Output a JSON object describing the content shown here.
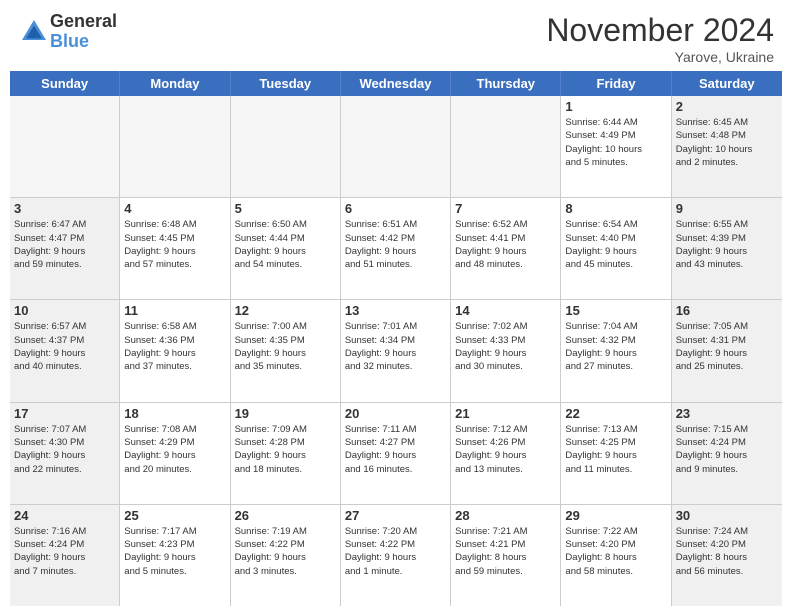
{
  "header": {
    "logo_general": "General",
    "logo_blue": "Blue",
    "month_title": "November 2024",
    "location": "Yarove, Ukraine"
  },
  "weekdays": [
    "Sunday",
    "Monday",
    "Tuesday",
    "Wednesday",
    "Thursday",
    "Friday",
    "Saturday"
  ],
  "rows": [
    [
      {
        "day": "",
        "empty": true
      },
      {
        "day": "",
        "empty": true
      },
      {
        "day": "",
        "empty": true
      },
      {
        "day": "",
        "empty": true
      },
      {
        "day": "",
        "empty": true
      },
      {
        "day": "1",
        "info": "Sunrise: 6:44 AM\nSunset: 4:49 PM\nDaylight: 10 hours\nand 5 minutes."
      },
      {
        "day": "2",
        "info": "Sunrise: 6:45 AM\nSunset: 4:48 PM\nDaylight: 10 hours\nand 2 minutes."
      }
    ],
    [
      {
        "day": "3",
        "info": "Sunrise: 6:47 AM\nSunset: 4:47 PM\nDaylight: 9 hours\nand 59 minutes."
      },
      {
        "day": "4",
        "info": "Sunrise: 6:48 AM\nSunset: 4:45 PM\nDaylight: 9 hours\nand 57 minutes."
      },
      {
        "day": "5",
        "info": "Sunrise: 6:50 AM\nSunset: 4:44 PM\nDaylight: 9 hours\nand 54 minutes."
      },
      {
        "day": "6",
        "info": "Sunrise: 6:51 AM\nSunset: 4:42 PM\nDaylight: 9 hours\nand 51 minutes."
      },
      {
        "day": "7",
        "info": "Sunrise: 6:52 AM\nSunset: 4:41 PM\nDaylight: 9 hours\nand 48 minutes."
      },
      {
        "day": "8",
        "info": "Sunrise: 6:54 AM\nSunset: 4:40 PM\nDaylight: 9 hours\nand 45 minutes."
      },
      {
        "day": "9",
        "info": "Sunrise: 6:55 AM\nSunset: 4:39 PM\nDaylight: 9 hours\nand 43 minutes."
      }
    ],
    [
      {
        "day": "10",
        "info": "Sunrise: 6:57 AM\nSunset: 4:37 PM\nDaylight: 9 hours\nand 40 minutes."
      },
      {
        "day": "11",
        "info": "Sunrise: 6:58 AM\nSunset: 4:36 PM\nDaylight: 9 hours\nand 37 minutes."
      },
      {
        "day": "12",
        "info": "Sunrise: 7:00 AM\nSunset: 4:35 PM\nDaylight: 9 hours\nand 35 minutes."
      },
      {
        "day": "13",
        "info": "Sunrise: 7:01 AM\nSunset: 4:34 PM\nDaylight: 9 hours\nand 32 minutes."
      },
      {
        "day": "14",
        "info": "Sunrise: 7:02 AM\nSunset: 4:33 PM\nDaylight: 9 hours\nand 30 minutes."
      },
      {
        "day": "15",
        "info": "Sunrise: 7:04 AM\nSunset: 4:32 PM\nDaylight: 9 hours\nand 27 minutes."
      },
      {
        "day": "16",
        "info": "Sunrise: 7:05 AM\nSunset: 4:31 PM\nDaylight: 9 hours\nand 25 minutes."
      }
    ],
    [
      {
        "day": "17",
        "info": "Sunrise: 7:07 AM\nSunset: 4:30 PM\nDaylight: 9 hours\nand 22 minutes."
      },
      {
        "day": "18",
        "info": "Sunrise: 7:08 AM\nSunset: 4:29 PM\nDaylight: 9 hours\nand 20 minutes."
      },
      {
        "day": "19",
        "info": "Sunrise: 7:09 AM\nSunset: 4:28 PM\nDaylight: 9 hours\nand 18 minutes."
      },
      {
        "day": "20",
        "info": "Sunrise: 7:11 AM\nSunset: 4:27 PM\nDaylight: 9 hours\nand 16 minutes."
      },
      {
        "day": "21",
        "info": "Sunrise: 7:12 AM\nSunset: 4:26 PM\nDaylight: 9 hours\nand 13 minutes."
      },
      {
        "day": "22",
        "info": "Sunrise: 7:13 AM\nSunset: 4:25 PM\nDaylight: 9 hours\nand 11 minutes."
      },
      {
        "day": "23",
        "info": "Sunrise: 7:15 AM\nSunset: 4:24 PM\nDaylight: 9 hours\nand 9 minutes."
      }
    ],
    [
      {
        "day": "24",
        "info": "Sunrise: 7:16 AM\nSunset: 4:24 PM\nDaylight: 9 hours\nand 7 minutes."
      },
      {
        "day": "25",
        "info": "Sunrise: 7:17 AM\nSunset: 4:23 PM\nDaylight: 9 hours\nand 5 minutes."
      },
      {
        "day": "26",
        "info": "Sunrise: 7:19 AM\nSunset: 4:22 PM\nDaylight: 9 hours\nand 3 minutes."
      },
      {
        "day": "27",
        "info": "Sunrise: 7:20 AM\nSunset: 4:22 PM\nDaylight: 9 hours\nand 1 minute."
      },
      {
        "day": "28",
        "info": "Sunrise: 7:21 AM\nSunset: 4:21 PM\nDaylight: 8 hours\nand 59 minutes."
      },
      {
        "day": "29",
        "info": "Sunrise: 7:22 AM\nSunset: 4:20 PM\nDaylight: 8 hours\nand 58 minutes."
      },
      {
        "day": "30",
        "info": "Sunrise: 7:24 AM\nSunset: 4:20 PM\nDaylight: 8 hours\nand 56 minutes."
      }
    ]
  ]
}
